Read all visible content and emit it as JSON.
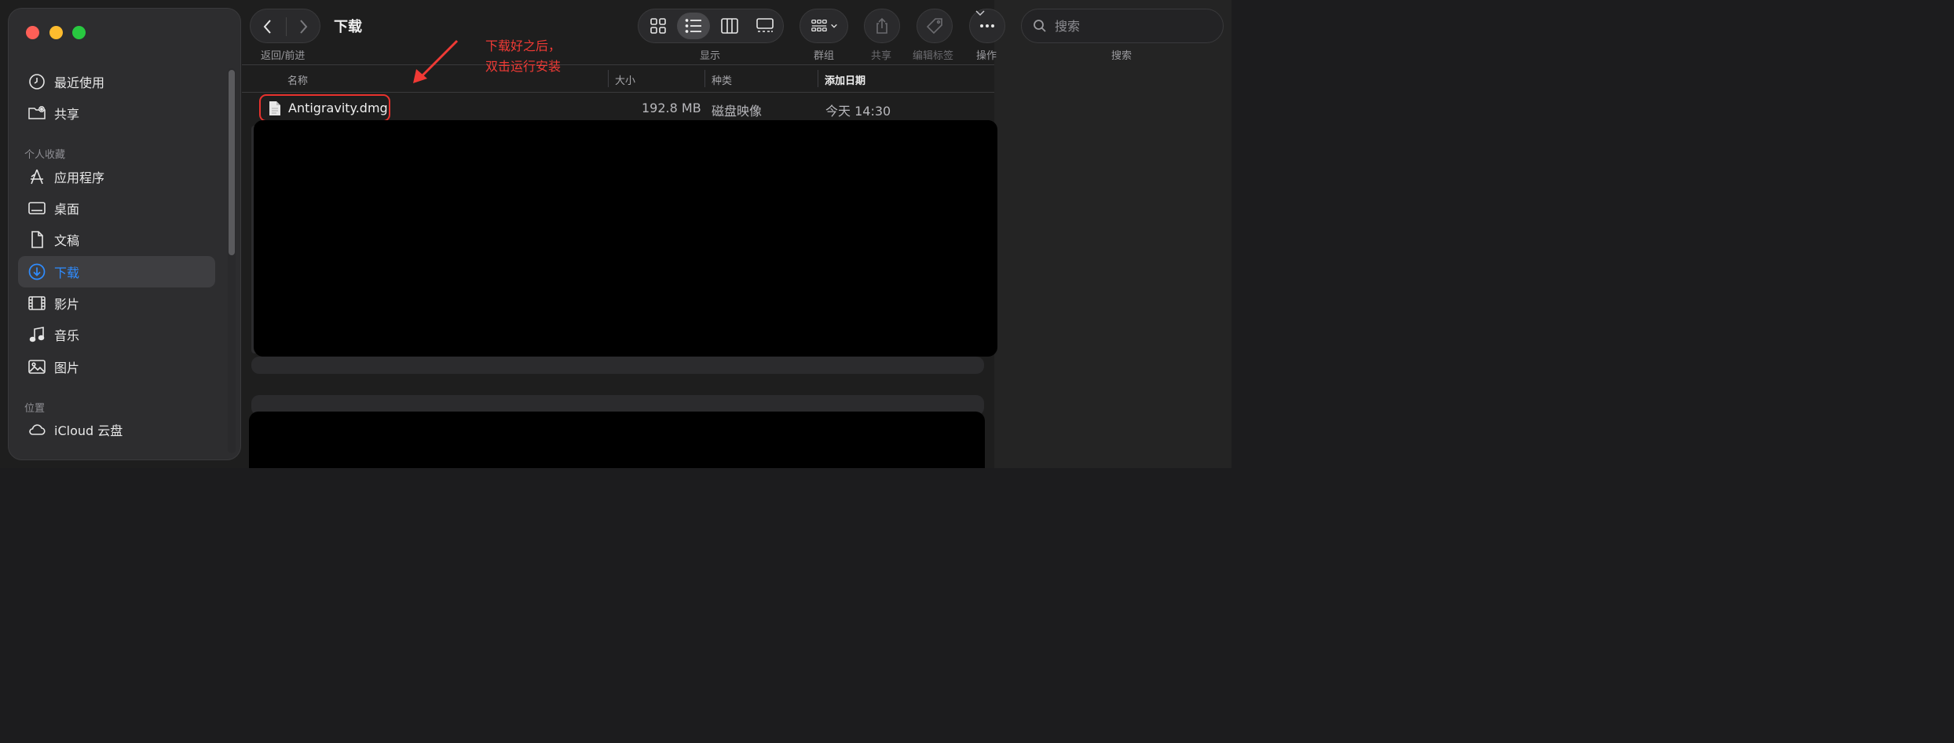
{
  "window": {
    "title": "下载"
  },
  "toolbar": {
    "back_forward_label": "返回/前进",
    "view_label": "显示",
    "group_label": "群组",
    "share_label": "共享",
    "tags_label": "编辑标签",
    "action_label": "操作",
    "search_label": "搜索",
    "search_placeholder": "搜索",
    "view_modes": [
      "icon-view",
      "list-view",
      "column-view",
      "gallery-view"
    ],
    "active_view": "list-view"
  },
  "sidebar": {
    "items_top": [
      {
        "label": "最近使用",
        "icon": "clock-icon"
      },
      {
        "label": "共享",
        "icon": "shared-folder-icon"
      }
    ],
    "favorites_header": "个人收藏",
    "favorites": [
      {
        "label": "应用程序",
        "icon": "applications-icon"
      },
      {
        "label": "桌面",
        "icon": "desktop-icon"
      },
      {
        "label": "文稿",
        "icon": "document-icon"
      },
      {
        "label": "下载",
        "icon": "download-icon",
        "active": true
      },
      {
        "label": "影片",
        "icon": "film-icon"
      },
      {
        "label": "音乐",
        "icon": "music-icon"
      },
      {
        "label": "图片",
        "icon": "photo-icon"
      }
    ],
    "locations_header": "位置",
    "locations": [
      {
        "label": "iCloud 云盘",
        "icon": "cloud-icon"
      }
    ],
    "accent_color": "#2f8cff"
  },
  "list": {
    "columns": {
      "name": "名称",
      "size": "大小",
      "kind": "种类",
      "date_added": "添加日期"
    },
    "sorted_by": "date_added",
    "files": [
      {
        "name": "Antigravity.dmg",
        "size": "192.8 MB",
        "kind": "磁盘映像",
        "date_added": "今天 14:30",
        "highlighted": true
      }
    ]
  },
  "annotation": {
    "text": "下载好之后，\n双击运行安装",
    "color": "#f03a35"
  }
}
